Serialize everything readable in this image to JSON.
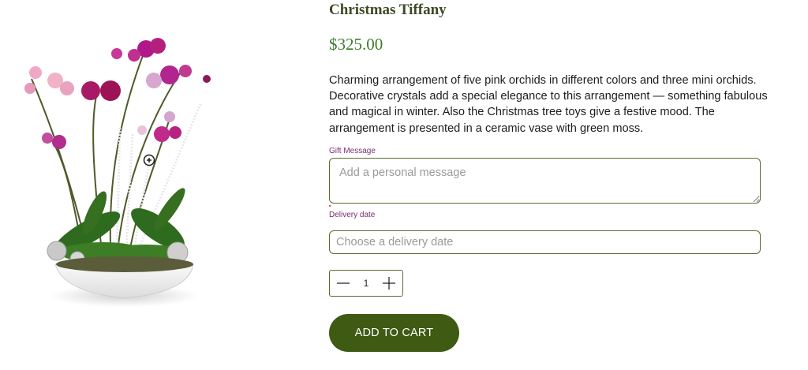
{
  "product": {
    "title": "Christmas Tiffany",
    "price": "$325.00",
    "description": "Charming arrangement of five pink orchids in different colors and three mini orchids. Decorative crystals add a special elegance to this arrangement — something fabulous and magical in winter. Also the Christmas tree toys give a festive mood. The arrangement is presented in a ceramic vase with green moss."
  },
  "form": {
    "gift_message": {
      "label": "Gift Message",
      "placeholder": "Add a personal message"
    },
    "delivery_date": {
      "label": "Delivery date",
      "placeholder": "Choose a delivery date"
    },
    "quantity": {
      "value": "1"
    },
    "add_to_cart_label": "ADD TO CART"
  },
  "icons": {
    "zoom": "zoom-in-icon",
    "minus": "minus-icon",
    "plus": "plus-icon"
  },
  "colors": {
    "brand_dark_green": "#3e5a13",
    "title_green": "#3b4a24",
    "price_green": "#3f7a2c",
    "label_plum": "#7b2d6f",
    "field_border": "#5d6b32"
  }
}
